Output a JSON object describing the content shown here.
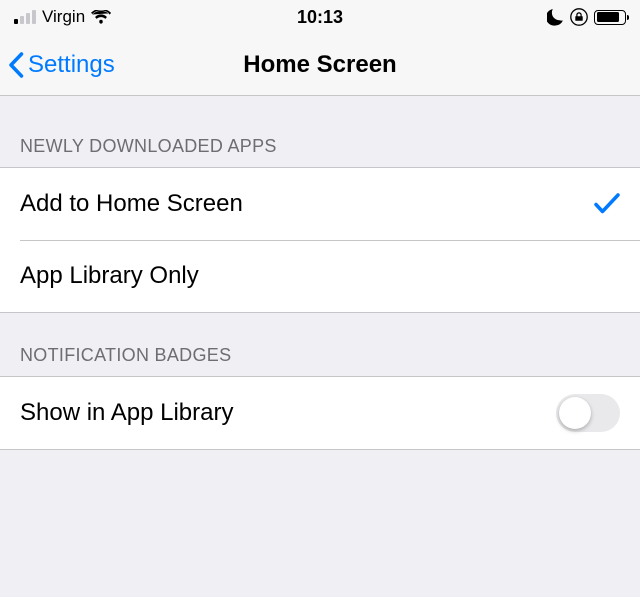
{
  "statusBar": {
    "carrier": "Virgin",
    "time": "10:13"
  },
  "nav": {
    "backLabel": "Settings",
    "title": "Home Screen"
  },
  "sections": {
    "newApps": {
      "header": "NEWLY DOWNLOADED APPS",
      "options": [
        {
          "label": "Add to Home Screen",
          "selected": true
        },
        {
          "label": "App Library Only",
          "selected": false
        }
      ]
    },
    "badges": {
      "header": "NOTIFICATION BADGES",
      "toggle": {
        "label": "Show in App Library",
        "on": false
      }
    }
  }
}
